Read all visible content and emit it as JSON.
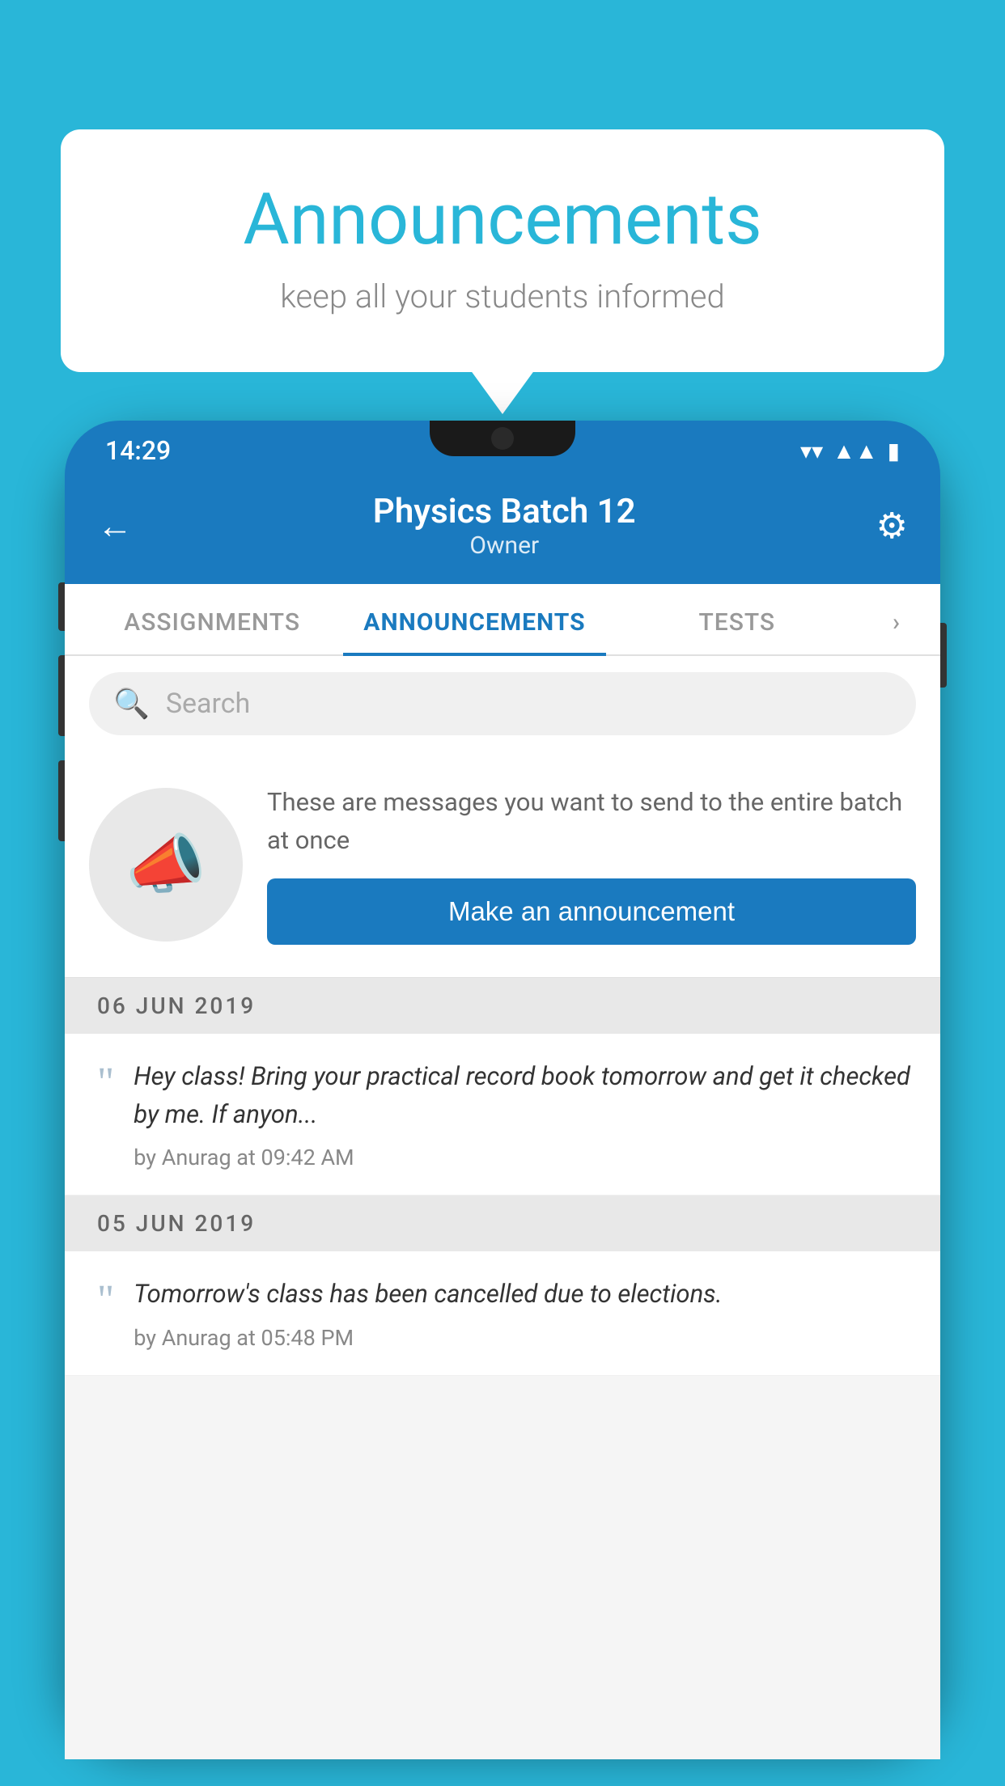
{
  "background_color": "#29b6d8",
  "speech_bubble": {
    "title": "Announcements",
    "subtitle": "keep all your students informed"
  },
  "phone": {
    "status_bar": {
      "time": "14:29",
      "wifi": "▼",
      "signal": "▲",
      "battery": "▮"
    },
    "header": {
      "title": "Physics Batch 12",
      "subtitle": "Owner",
      "back_label": "←",
      "settings_label": "⚙"
    },
    "tabs": [
      {
        "label": "ASSIGNMENTS",
        "active": false
      },
      {
        "label": "ANNOUNCEMENTS",
        "active": true
      },
      {
        "label": "TESTS",
        "active": false
      }
    ],
    "search": {
      "placeholder": "Search"
    },
    "announcement_prompt": {
      "description": "These are messages you want to send to the entire batch at once",
      "button_label": "Make an announcement"
    },
    "announcements": [
      {
        "date": "06  JUN  2019",
        "text": "Hey class! Bring your practical record book tomorrow and get it checked by me. If anyon...",
        "meta": "by Anurag at 09:42 AM"
      },
      {
        "date": "05  JUN  2019",
        "text": "Tomorrow's class has been cancelled due to elections.",
        "meta": "by Anurag at 05:48 PM"
      }
    ]
  }
}
